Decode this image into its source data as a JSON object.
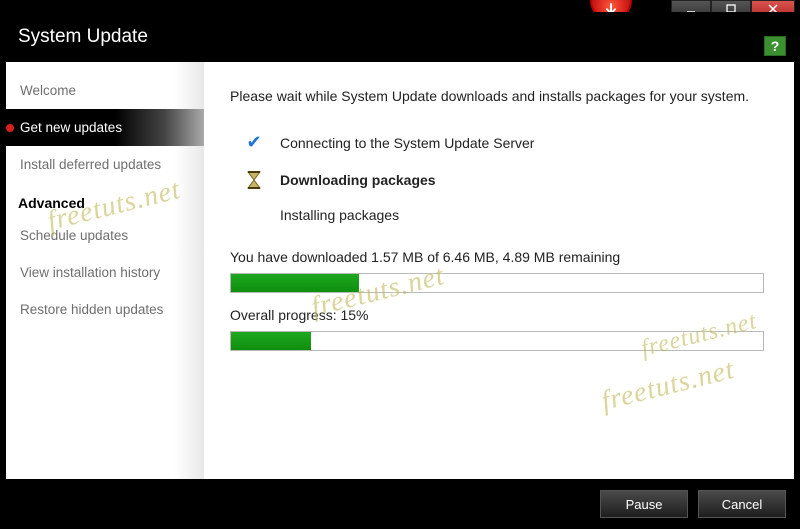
{
  "window": {
    "title": "System Update"
  },
  "sidebar": {
    "items": [
      {
        "label": "Welcome",
        "selected": false
      },
      {
        "label": "Get new updates",
        "selected": true
      },
      {
        "label": "Install deferred updates",
        "selected": false
      }
    ],
    "advanced_heading": "Advanced",
    "advanced_items": [
      {
        "label": "Schedule updates"
      },
      {
        "label": "View installation history"
      },
      {
        "label": "Restore hidden updates"
      }
    ]
  },
  "content": {
    "intro": "Please wait while System Update downloads and installs packages for your system.",
    "step_connect": "Connecting to the System Update Server",
    "step_download": "Downloading packages",
    "step_install": "Installing packages",
    "downloaded_text": "You have downloaded  1.57 MB of  6.46 MB,  4.89 MB remaining",
    "download_progress_percent": 24,
    "overall_text": "Overall progress: 15%",
    "overall_progress_percent": 15
  },
  "footer": {
    "pause": "Pause",
    "cancel": "Cancel"
  },
  "watermark": "freetuts.net"
}
